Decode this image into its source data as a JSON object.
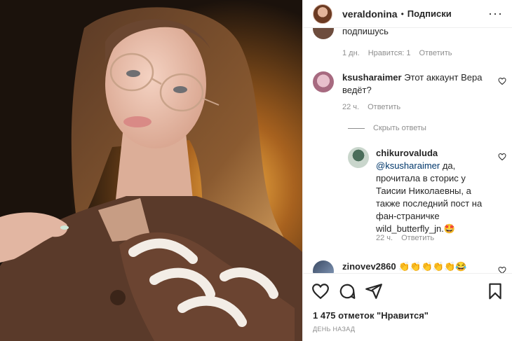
{
  "header": {
    "username": "veraldonina",
    "dot": "•",
    "follow_label": "Подписки",
    "more": "···"
  },
  "comments": [
    {
      "text_tail": "подпишусь",
      "time": "1 дн.",
      "likes": "Нравится: 1",
      "reply": "Ответить"
    },
    {
      "username": "ksusharaimer",
      "text": "Этот аккаунт Вера ведёт?",
      "time": "22 ч.",
      "reply": "Ответить",
      "hide_replies": "Скрыть ответы",
      "replies": [
        {
          "username": "chikurovaluda",
          "mention": "@ksusharaimer",
          "text": " да, прочитала в сторис у Таисии Николаевны, а также последний пост на фан-страничке wild_butterfly_jn.",
          "emoji": "🤩",
          "time": "22 ч.",
          "reply": "Ответить"
        }
      ]
    },
    {
      "username": "zinovev2860",
      "text": "👏👏👏👏👏😂"
    }
  ],
  "actions": {
    "like_icon": "heart-icon",
    "comment_icon": "comment-icon",
    "share_icon": "share-icon",
    "save_icon": "bookmark-icon"
  },
  "likes_text": "1 475 отметок \"Нравится\"",
  "date_text": "ДЕНЬ НАЗАД",
  "colors": {
    "text": "#262626",
    "muted": "#8e8e8e",
    "mention": "#00376b",
    "border": "#efefef"
  }
}
